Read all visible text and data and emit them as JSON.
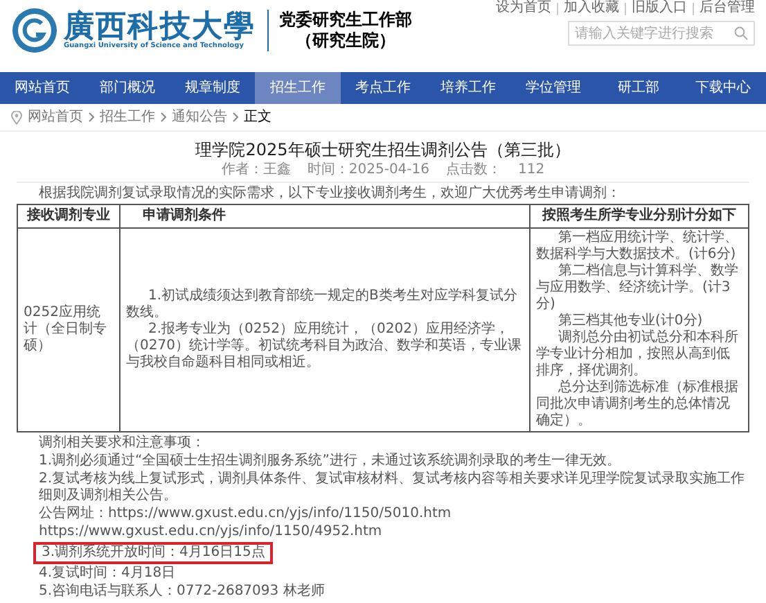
{
  "header": {
    "logo_text": "廣西科技大學",
    "logo_subtitle": "Guangxi University of Science and Technology",
    "department": "党委研究生工作部",
    "department_sub": "（研究生院）",
    "top_links": [
      "设为首页",
      "加入收藏",
      "旧版入口",
      "后台管理"
    ],
    "search": {
      "placeholder": "请输入关键字进行搜索"
    }
  },
  "nav": [
    {
      "label": "网站首页",
      "selected": false
    },
    {
      "label": "部门概况",
      "selected": false
    },
    {
      "label": "规章制度",
      "selected": false
    },
    {
      "label": "招生工作",
      "selected": true
    },
    {
      "label": "考点工作",
      "selected": false
    },
    {
      "label": "培养工作",
      "selected": false
    },
    {
      "label": "学位管理",
      "selected": false
    },
    {
      "label": "研工部",
      "selected": false
    },
    {
      "label": "下载中心",
      "selected": false
    }
  ],
  "breadcrumb": [
    "网站首页",
    "招生工作",
    "通知公告",
    "正文"
  ],
  "article": {
    "title": "理学院2025年硕士研究生招生调剂公告（第三批）",
    "meta": [
      "作者：王鑫",
      "时间：2025-04-16",
      "点击数：",
      "112"
    ],
    "intro": "根据我院调剂复试录取情况的实际需求，以下专业接收调剂考生，欢迎广大优秀考生申请调剂：",
    "table": {
      "columns": [
        "接收调剂专业",
        "申请调剂条件",
        "按照考生所学专业分别计分如下"
      ],
      "rows": [
        {
          "major": "0252应用统计（全日制专硕）",
          "conditions": [
            "1.初试成绩须达到教育部统一规定的B类考生对应学科复试分数线。",
            "2.报考专业为（0252）应用统计，（0202）应用经济学，（0270）统计学等。初试统考科目为政治、数学和英语，专业课与我校自命题科目相同或相近。"
          ],
          "scoring": [
            "第一档应用统计学、统计学、数据科学与大数据技术。(计6分)",
            "第二档信息与计算科学、数学与应用数学、经济统计学。(计3 分)",
            "第三档其他专业(计0分)",
            "调剂总分由初试总分和本科所学专业计分相加，按照从高到低排序，择优调剂。",
            "总分达到筛选标准（标准根据同批次申请调剂考生的总体情况确定）。"
          ]
        }
      ]
    },
    "notes": [
      {
        "text": "调剂相关要求和注意事项：",
        "highlighted": false
      },
      {
        "text": "1.调剂必须通过“全国硕士生招生调剂服务系统”进行，未通过该系统调剂录取的考生一律无效。",
        "highlighted": false
      },
      {
        "text": "2.复试考核为线上复试形式，调剂具体条件、复试审核材料、复试考核内容等相关要求详见理学院复试录取实施工作细则及调剂相关公告。",
        "highlighted": false
      },
      {
        "text": "公告网址：https://www.gxust.edu.cn/yjs/info/1150/5010.htm",
        "highlighted": false
      },
      {
        "text": "https://www.gxust.edu.cn/yjs/info/1150/4952.htm",
        "highlighted": false
      },
      {
        "text": "3.调剂系统开放时间：4月16日15点",
        "highlighted": true
      },
      {
        "text": "4.复试时间：4月18日",
        "highlighted": false
      },
      {
        "text": "5.咨询电话与联系人：0772-2687093 林老师",
        "highlighted": false
      }
    ]
  }
}
